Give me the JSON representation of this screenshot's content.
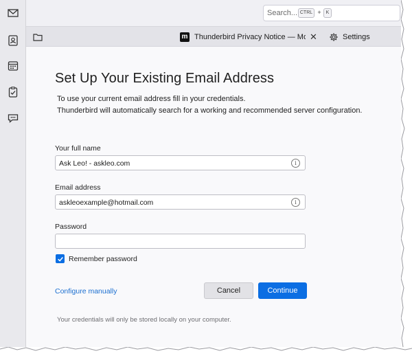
{
  "spaces": {
    "icons": [
      "mail-icon",
      "address-book-icon",
      "calendar-icon",
      "tasks-icon",
      "chat-icon"
    ]
  },
  "search": {
    "placeholder": "Search...",
    "shortcut_ctrl": "CTRL",
    "shortcut_plus": "+",
    "shortcut_key": "K"
  },
  "tabs": {
    "privacy_tab_title": "Thunderbird Privacy Notice — Mozilla",
    "privacy_tab_logo": "m",
    "settings_label": "Settings"
  },
  "form": {
    "title": "Set Up Your Existing Email Address",
    "intro_line1": "To use your current email address fill in your credentials.",
    "intro_line2": "Thunderbird will automatically search for a working and recommended server configuration.",
    "full_name_label": "Your full name",
    "full_name_value": "Ask Leo! - askleo.com",
    "email_label": "Email address",
    "email_value": "askleoexample@hotmail.com",
    "password_label": "Password",
    "password_value": "",
    "remember_label": "Remember password",
    "remember_checked": true,
    "configure_manually": "Configure manually",
    "cancel_label": "Cancel",
    "continue_label": "Continue",
    "note": "Your credentials will only be stored locally on your computer."
  },
  "colors": {
    "accent": "#0b6ee3",
    "link": "#1b6fd0",
    "sidebar_bg": "#e9e9ed",
    "content_bg": "#f9f9fb"
  }
}
